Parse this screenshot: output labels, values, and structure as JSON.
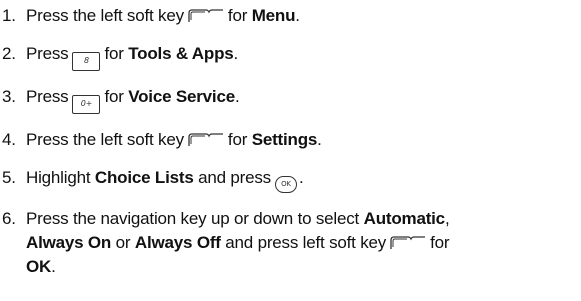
{
  "steps": [
    {
      "number": "1.",
      "before": "Press the left soft key",
      "after": "for",
      "bold": "Menu",
      "end": "."
    },
    {
      "number": "2.",
      "before": "Press",
      "key_label": "8",
      "after": "for",
      "bold": "Tools & Apps",
      "end": "."
    },
    {
      "number": "3.",
      "before": "Press",
      "key_label": "0+",
      "after": "for",
      "bold": "Voice Service",
      "end": "."
    },
    {
      "number": "4.",
      "before": "Press the left soft key",
      "after": "for",
      "bold": "Settings",
      "end": "."
    },
    {
      "number": "5.",
      "before": "Highlight",
      "bold": "Choice Lists",
      "after": "and press",
      "key_label": "OK",
      "end": "."
    },
    {
      "number": "6.",
      "text1": "Press the navigation key up or down to select",
      "bold1": "Automatic",
      "comma": ",",
      "bold2": "Always On",
      "or_text": "or",
      "bold3": "Always Off",
      "after": "and press left soft key",
      "for_text": "for",
      "bold4": "OK",
      "end": "."
    }
  ],
  "icons": {
    "soft_key": "left-soft-key-icon",
    "number_key": "number-key-icon",
    "ok_key": "ok-key-icon"
  }
}
